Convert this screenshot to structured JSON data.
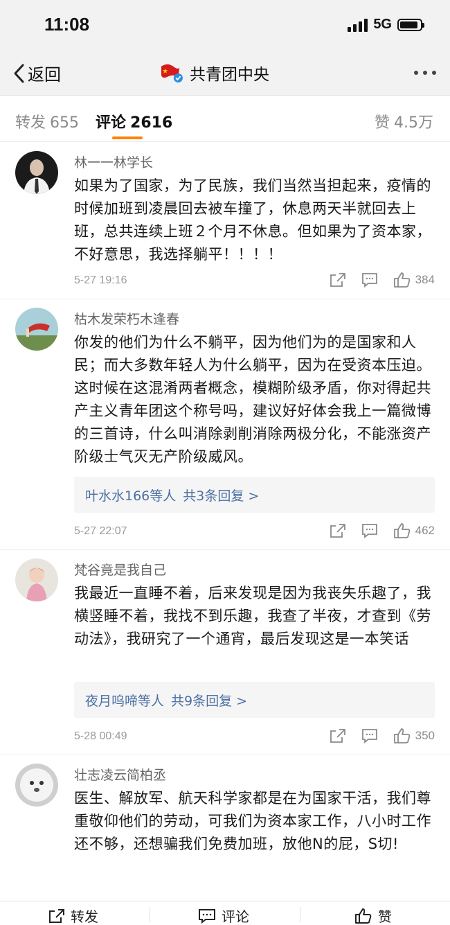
{
  "status_bar": {
    "time": "11:08",
    "network": "5G",
    "battery_level": 0.9
  },
  "nav": {
    "back_label": "返回",
    "title": "共青团中央",
    "logo_icon": "youth-league-flag-icon"
  },
  "tabs": [
    {
      "label": "转发",
      "count": "655"
    },
    {
      "label": "评论",
      "count": "2616"
    },
    {
      "label": "赞",
      "count": "4.5万"
    }
  ],
  "comments": [
    {
      "user": "林一一林学长",
      "text": "如果为了国家，为了民族，我们当然当担起来，疫情的时候加班到凌晨回去被车撞了，休息两天半就回去上班，总共连续上班２个月不休息。但如果为了资本家，不好意思，我选择躺平！！！！",
      "time": "5-27 19:16",
      "likes": "384",
      "reply_names": "",
      "reply_count": ""
    },
    {
      "user": "枯木发荣朽木逢春",
      "text": "你发的他们为什么不躺平，因为他们为的是国家和人民；而大多数年轻人为什么躺平，因为在受资本压迫。这时候在这混淆两者概念，模糊阶级矛盾，你对得起共产主义青年团这个称号吗，建议好好体会我上一篇微博的三首诗，什么叫消除剥削消除两极分化，不能涨资产阶级士气灭无产阶级威风。",
      "time": "5-27 22:07",
      "likes": "462",
      "reply_names": "叶水水166等人",
      "reply_count": "共3条回复 >"
    },
    {
      "user": "梵谷竟是我自己",
      "text": "我最近一直睡不着，后来发现是因为我丧失乐趣了，我横竖睡不着，我找不到乐趣，我查了半夜，才查到《劳动法》，我研究了一个通宵，最后发现这是一本笑话",
      "time": "5-28 00:49",
      "likes": "350",
      "reply_names": "夜月呜啼等人",
      "reply_count": "共9条回复 >"
    },
    {
      "user": "壮志凌云简柏丞",
      "text": "医生、解放军、航天科学家都是在为国家干活，我们尊重敬仰他们的劳动，可我们为资本家工作，八小时工作还不够，还想骗我们免费加班，放他N的屁，S切!",
      "time": "",
      "likes": "",
      "reply_names": "",
      "reply_count": ""
    }
  ],
  "bottom_bar": {
    "repost": "转发",
    "comment": "评论",
    "like": "赞"
  },
  "colors": {
    "accent": "#ff8200",
    "link": "#4a6fa5",
    "muted": "#9a9a9a"
  }
}
